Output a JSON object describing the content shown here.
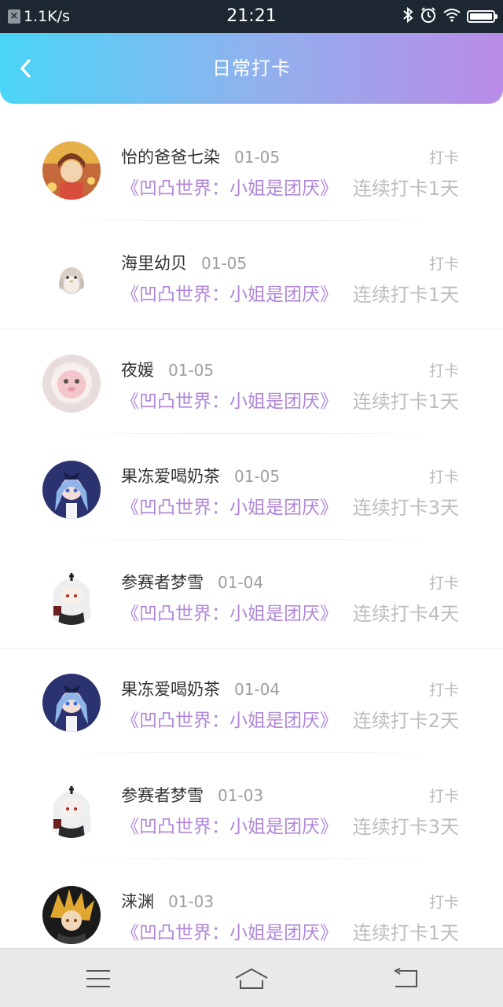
{
  "status_bar": {
    "speed": "1.1K/s",
    "time": "21:21"
  },
  "header": {
    "title": "日常打卡"
  },
  "entries": [
    {
      "name": "怡的爸爸七染",
      "date": "01-05",
      "book": "《凹凸世界：小姐是团厌》",
      "label": "打卡",
      "streak": "连续打卡1天"
    },
    {
      "name": "海里幼贝",
      "date": "01-05",
      "book": "《凹凸世界：小姐是团厌》",
      "label": "打卡",
      "streak": "连续打卡1天"
    },
    {
      "name": "夜媛",
      "date": "01-05",
      "book": "《凹凸世界：小姐是团厌》",
      "label": "打卡",
      "streak": "连续打卡1天"
    },
    {
      "name": "果冻爱喝奶茶",
      "date": "01-05",
      "book": "《凹凸世界：小姐是团厌》",
      "label": "打卡",
      "streak": "连续打卡3天"
    },
    {
      "name": "参赛者梦雪",
      "date": "01-04",
      "book": "《凹凸世界：小姐是团厌》",
      "label": "打卡",
      "streak": "连续打卡4天"
    },
    {
      "name": "果冻爱喝奶茶",
      "date": "01-04",
      "book": "《凹凸世界：小姐是团厌》",
      "label": "打卡",
      "streak": "连续打卡2天"
    },
    {
      "name": "参赛者梦雪",
      "date": "01-03",
      "book": "《凹凸世界：小姐是团厌》",
      "label": "打卡",
      "streak": "连续打卡3天"
    },
    {
      "name": "涞渊",
      "date": "01-03",
      "book": "《凹凸世界：小姐是团厌》",
      "label": "打卡",
      "streak": "连续打卡1天"
    }
  ],
  "colors": {
    "header_gradient_start": "#49d5f6",
    "header_gradient_end": "#b98be6",
    "book_title": "#b086d8"
  }
}
